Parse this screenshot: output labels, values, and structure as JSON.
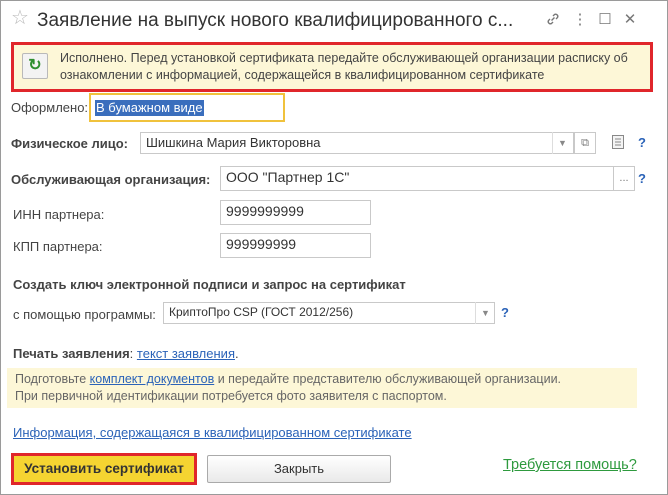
{
  "window": {
    "title": "Заявление на выпуск нового квалифицированного с..."
  },
  "banner": {
    "text": "Исполнено. Перед установкой сертификата передайте обслуживающей организации расписку об ознакомлении с информацией, содержащейся в квалифицированном сертификате"
  },
  "form": {
    "issued_label": "Оформлено:",
    "issued_value": "В бумажном виде",
    "person_label": "Физическое лицо:",
    "person_value": "Шишкина Мария Викторовна",
    "org_label": "Обслуживающая организация:",
    "org_value": "ООО \"Партнер 1С\"",
    "inn_label": "ИНН партнера:",
    "inn_value": "9999999999",
    "kpp_label": "КПП партнера:",
    "kpp_value": "999999999",
    "key_section_title": "Создать ключ электронной подписи и запрос на сертификат",
    "program_label": "с помощью программы:",
    "program_value": "КриптоПро CSP (ГОСТ 2012/256)",
    "print_label": "Печать заявления",
    "print_colon": ": ",
    "print_link": "текст заявления",
    "print_dot": "."
  },
  "note": {
    "part1": "Подготовьте ",
    "link": "комплект документов",
    "part2": " и передайте представителю обслуживающей организации.",
    "line2": "При первичной идентификации потребуется фото заявителя с паспортом."
  },
  "info_link": "Информация, содержащаяся в квалифицированном сертификате",
  "buttons": {
    "install": "Установить сертификат",
    "close": "Закрыть",
    "help": "Требуется помощь?"
  },
  "icons": {
    "star": "☆",
    "link": "🔗",
    "more": "⋮",
    "maximize": "☐",
    "close": "✕",
    "refresh": "↻",
    "dropdown": "▼",
    "open": "⧉",
    "ellipsis": "...",
    "question": "?"
  }
}
